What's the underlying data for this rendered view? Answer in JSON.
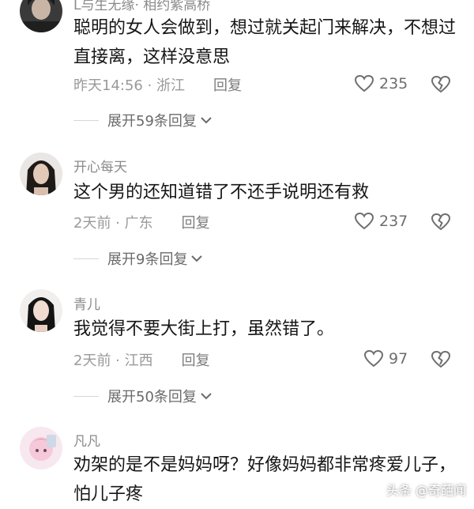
{
  "comments": [
    {
      "username": "L与生无缘· 相约紫高桥",
      "text": "聪明的女人会做到，想过就关起门来解决，不想过直接离，这样没意思",
      "meta": "昨天14:56 · 浙江",
      "reply_label": "回复",
      "likes": "235",
      "expand_label": "展开59条回复"
    },
    {
      "username": "开心每天",
      "text": "这个男的还知道错了不还手说明还有救",
      "meta": "2天前 · 广东",
      "reply_label": "回复",
      "likes": "237",
      "expand_label": "展开9条回复"
    },
    {
      "username": "青儿",
      "text": "我觉得不要大街上打，虽然错了。",
      "meta": "2天前 · 江西",
      "reply_label": "回复",
      "likes": "97",
      "expand_label": "展开50条回复"
    },
    {
      "username": "凡凡",
      "text": "劝架的是不是妈妈呀？好像妈妈都非常疼爱儿子，怕儿子疼",
      "meta": "",
      "reply_label": "",
      "likes": "",
      "expand_label": ""
    }
  ],
  "watermark": "头条 @奇葩闻",
  "icons": {
    "like": "heart-outline-icon",
    "dislike": "broken-heart-icon",
    "expand": "chevron-down-icon"
  },
  "colors": {
    "text": "#161616",
    "secondary": "#9a9a9a",
    "icon": "#6e6e6e"
  }
}
